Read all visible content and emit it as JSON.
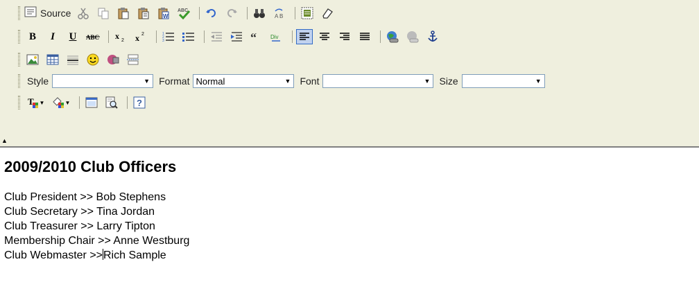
{
  "toolbar": {
    "source_label": "Source",
    "style_label": "Style",
    "style_value": "",
    "format_label": "Format",
    "format_value": "Normal",
    "font_label": "Font",
    "font_value": "",
    "size_label": "Size",
    "size_value": ""
  },
  "content": {
    "heading": "2009/2010 Club Officers",
    "officers": [
      {
        "role": "Club President",
        "sep": ">>",
        "name": "Bob Stephens"
      },
      {
        "role": "Club Secretary",
        "sep": ">>",
        "name": "Tina Jordan"
      },
      {
        "role": "Club Treasurer",
        "sep": ">>",
        "name": "Larry Tipton"
      },
      {
        "role": "Membership Chair",
        "sep": ">>",
        "name": "Anne Westburg"
      },
      {
        "role": "Club Webmaster",
        "sep": ">>",
        "name": "Rich Sample"
      }
    ]
  },
  "colors": {
    "toolbar_bg": "#efefde",
    "active_bg": "#c1d2ee",
    "active_border": "#316ac5"
  }
}
